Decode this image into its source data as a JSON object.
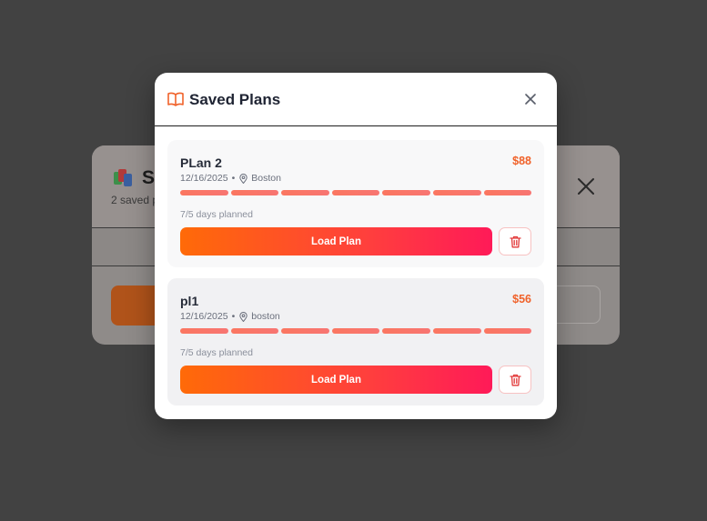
{
  "background_modal": {
    "title": "Sa",
    "subtitle": "2 saved p",
    "close_icon": "close-icon",
    "icon": "books-icon"
  },
  "modal": {
    "title": "Saved Plans",
    "title_icon": "book-open-icon",
    "close_icon": "close-icon",
    "accent_color": "#f0622a"
  },
  "plans": [
    {
      "name": "PLan 2",
      "price": "$88",
      "date": "12/16/2025",
      "separator": "•",
      "location": "Boston",
      "days_planned": 7,
      "days_total": 5,
      "status": "7/5 days planned",
      "load_label": "Load Plan",
      "delete_icon": "trash-icon"
    },
    {
      "name": "pl1",
      "price": "$56",
      "date": "12/16/2025",
      "separator": "•",
      "location": "boston",
      "days_planned": 7,
      "days_total": 5,
      "status": "7/5 days planned",
      "load_label": "Load Plan",
      "delete_icon": "trash-icon"
    }
  ]
}
